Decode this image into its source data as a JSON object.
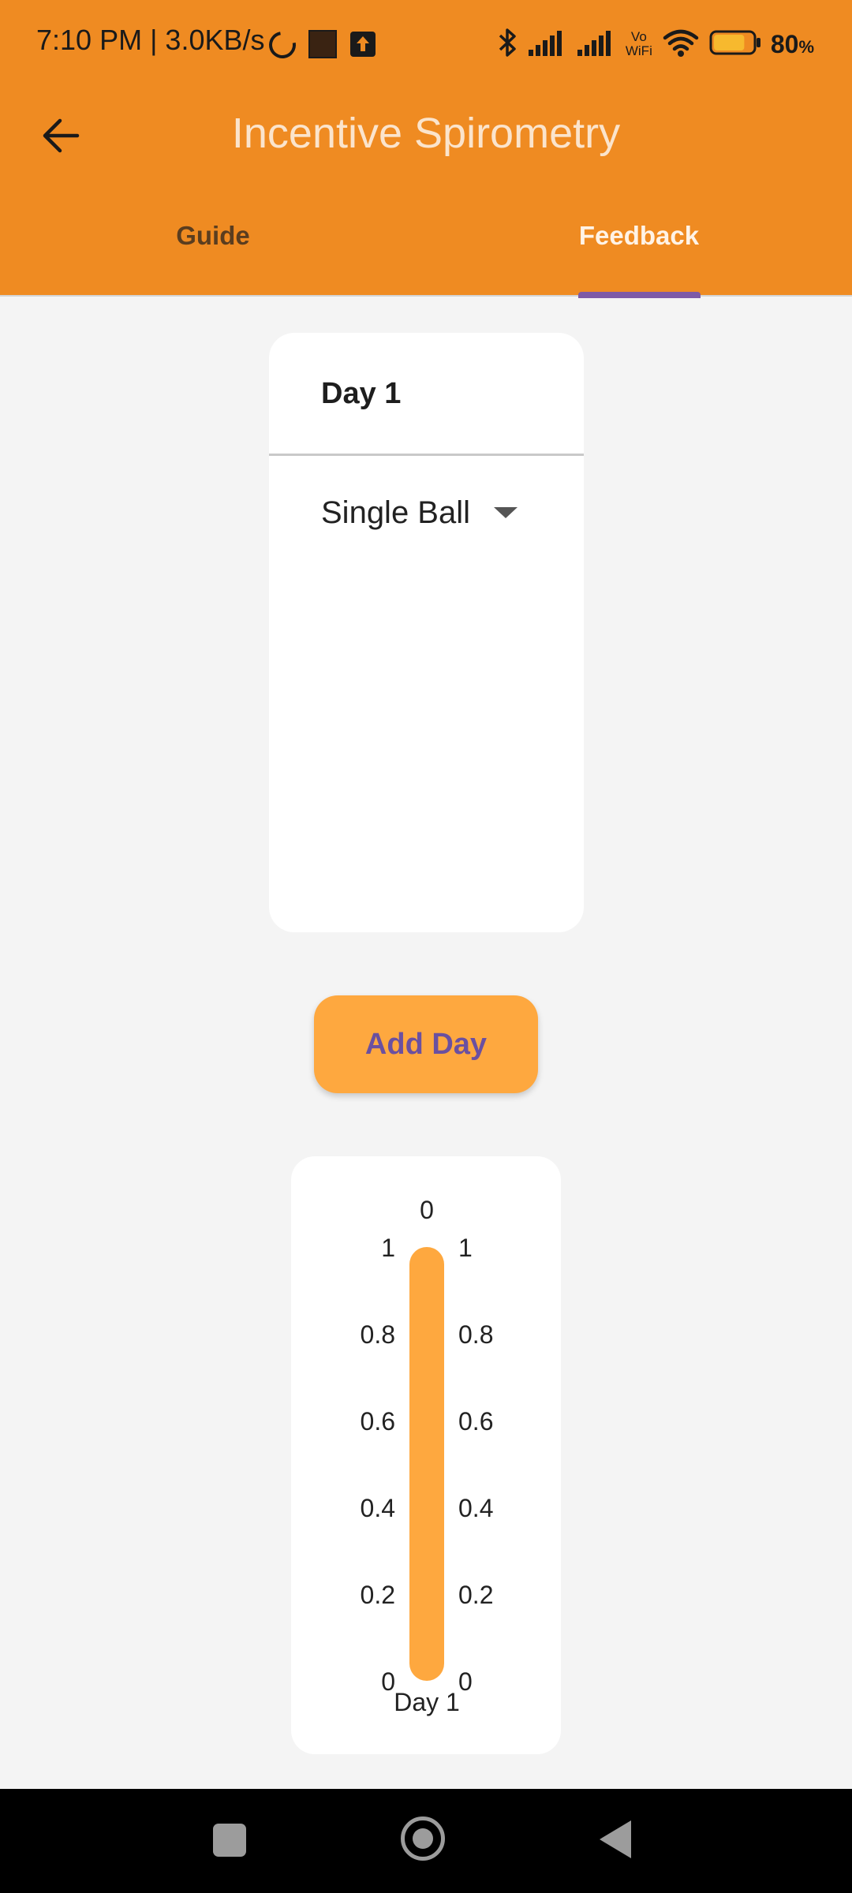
{
  "status_bar": {
    "time": "7:10 PM | 3.0KB/s",
    "battery_percent": "80",
    "battery_unit": "%",
    "vowifi_line1": "Vo",
    "vowifi_line2": "WiFi",
    "battery_level": 0.8,
    "icons": [
      "loading-icon",
      "notification-square-icon",
      "upload-icon",
      "bluetooth-icon",
      "signal-icon",
      "signal-icon",
      "vowifi-icon",
      "wifi-icon",
      "battery-icon"
    ]
  },
  "app_bar": {
    "title": "Incentive Spirometry",
    "back_icon": "arrow-left-icon",
    "tabs": [
      {
        "label": "Guide",
        "selected": false
      },
      {
        "label": "Feedback",
        "selected": true
      }
    ]
  },
  "day_card": {
    "day_label": "Day 1",
    "dropdown_value": "Single Ball",
    "dropdown_icon": "caret-down-icon"
  },
  "add_day_button": {
    "label": "Add Day"
  },
  "chart_data": {
    "type": "bar",
    "categories": [
      "Day 1"
    ],
    "values": [
      1
    ],
    "bar_top_label": "0",
    "left_axis_ticks": [
      "0",
      "0.2",
      "0.4",
      "0.6",
      "0.8",
      "1"
    ],
    "right_axis_ticks": [
      "0",
      "0.2",
      "0.4",
      "0.6",
      "0.8",
      "1"
    ],
    "ylim": [
      0,
      1
    ],
    "bar_color": "#fea83f",
    "grid": false
  },
  "nav_bar": {
    "icons": [
      "recents-square-icon",
      "home-circle-icon",
      "back-triangle-icon"
    ]
  },
  "colors": {
    "primary": "#ef8b22",
    "accent": "#fea83f",
    "indicator": "#7d5ba6",
    "button_text": "#6b50a0",
    "background": "#f4f4f4"
  }
}
